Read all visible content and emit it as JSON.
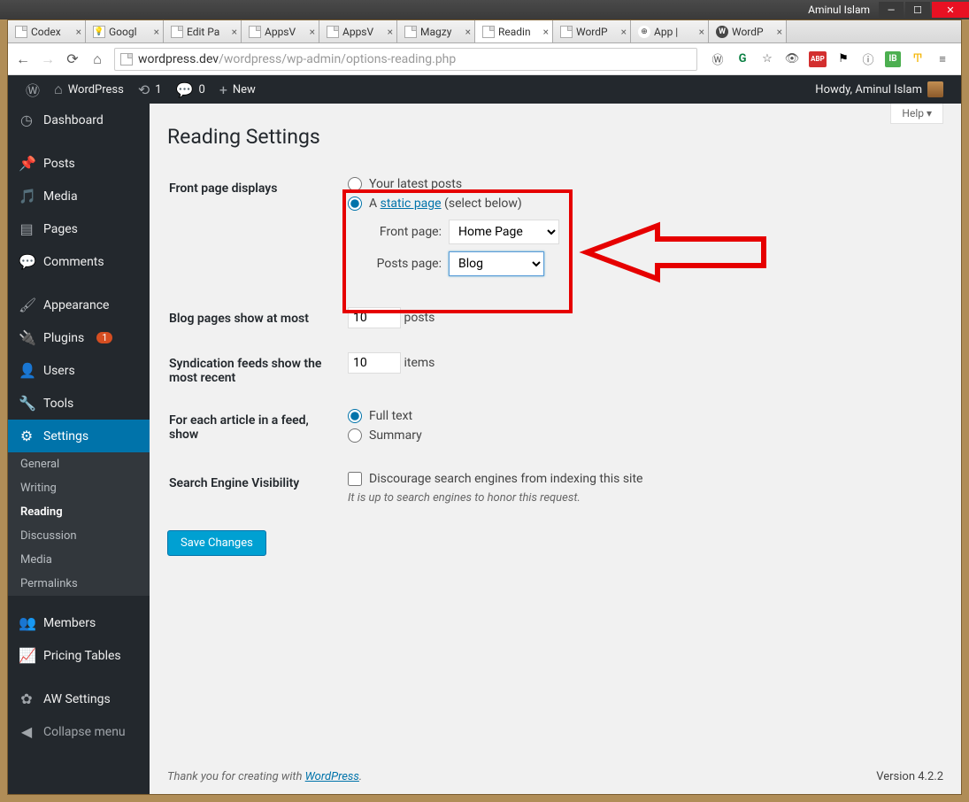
{
  "window": {
    "user": "Aminul Islam"
  },
  "tabs": [
    {
      "title": "Codex",
      "type": "generic"
    },
    {
      "title": "Googl",
      "type": "google"
    },
    {
      "title": "Edit Pa",
      "type": "generic"
    },
    {
      "title": "AppsV",
      "type": "generic"
    },
    {
      "title": "AppsV",
      "type": "generic"
    },
    {
      "title": "Magzy",
      "type": "generic"
    },
    {
      "title": "Readin",
      "type": "generic",
      "active": true
    },
    {
      "title": "WordP",
      "type": "generic"
    },
    {
      "title": "App |",
      "type": "app"
    },
    {
      "title": "WordP",
      "type": "wp"
    }
  ],
  "url": {
    "host": "wordpress.dev",
    "path": "/wordpress/wp-admin/options-reading.php"
  },
  "adminbar": {
    "site": "WordPress",
    "updates": "1",
    "comments": "0",
    "new": "New",
    "howdy": "Howdy, Aminul Islam"
  },
  "menu": {
    "dashboard": "Dashboard",
    "posts": "Posts",
    "media": "Media",
    "pages": "Pages",
    "comments": "Comments",
    "appearance": "Appearance",
    "plugins": "Plugins",
    "plugins_badge": "1",
    "users": "Users",
    "tools": "Tools",
    "settings": "Settings",
    "submenu": {
      "general": "General",
      "writing": "Writing",
      "reading": "Reading",
      "discussion": "Discussion",
      "media": "Media",
      "permalinks": "Permalinks"
    },
    "members": "Members",
    "pricing": "Pricing Tables",
    "aw": "AW Settings",
    "collapse": "Collapse menu"
  },
  "page": {
    "help": "Help ▾",
    "title": "Reading Settings",
    "labels": {
      "front_page_displays": "Front page displays",
      "latest_posts": "Your latest posts",
      "static_page_prefix": "A ",
      "static_page_link": "static page",
      "static_page_suffix": " (select below)",
      "front_page": "Front page:",
      "posts_page": "Posts page:",
      "front_page_select": "Home Page",
      "posts_page_select": "Blog",
      "blog_pages_show": "Blog pages show at most",
      "blog_pages_value": "10",
      "posts_word": "posts",
      "syndication": "Syndication feeds show the most recent",
      "syndication_value": "10",
      "items_word": "items",
      "feed_article": "For each article in a feed, show",
      "full_text": "Full text",
      "summary": "Summary",
      "search_visibility": "Search Engine Visibility",
      "discourage": "Discourage search engines from indexing this site",
      "discourage_desc": "It is up to search engines to honor this request.",
      "save": "Save Changes"
    },
    "footer": {
      "thanks_prefix": "Thank you for creating with ",
      "wp_link": "WordPress",
      "thanks_suffix": ".",
      "version": "Version 4.2.2"
    }
  }
}
